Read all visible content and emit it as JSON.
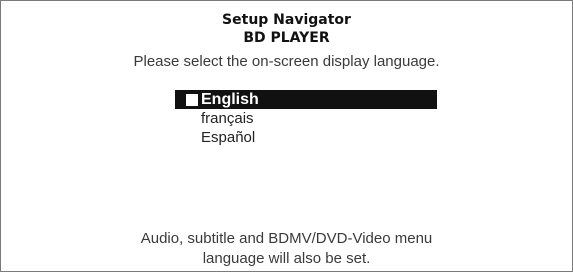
{
  "header": {
    "title": "Setup Navigator",
    "subtitle": "BD PLAYER"
  },
  "prompt": "Please select the on-screen display language.",
  "languages": [
    {
      "label": "English",
      "selected": true
    },
    {
      "label": "français",
      "selected": false
    },
    {
      "label": "Español",
      "selected": false
    }
  ],
  "footer": {
    "line1": "Audio, subtitle and BDMV/DVD-Video menu",
    "line2": "language will also be set."
  },
  "colors": {
    "selection_bg": "#111111",
    "selection_text": "#ffffff",
    "border": "#7a7a7a"
  }
}
